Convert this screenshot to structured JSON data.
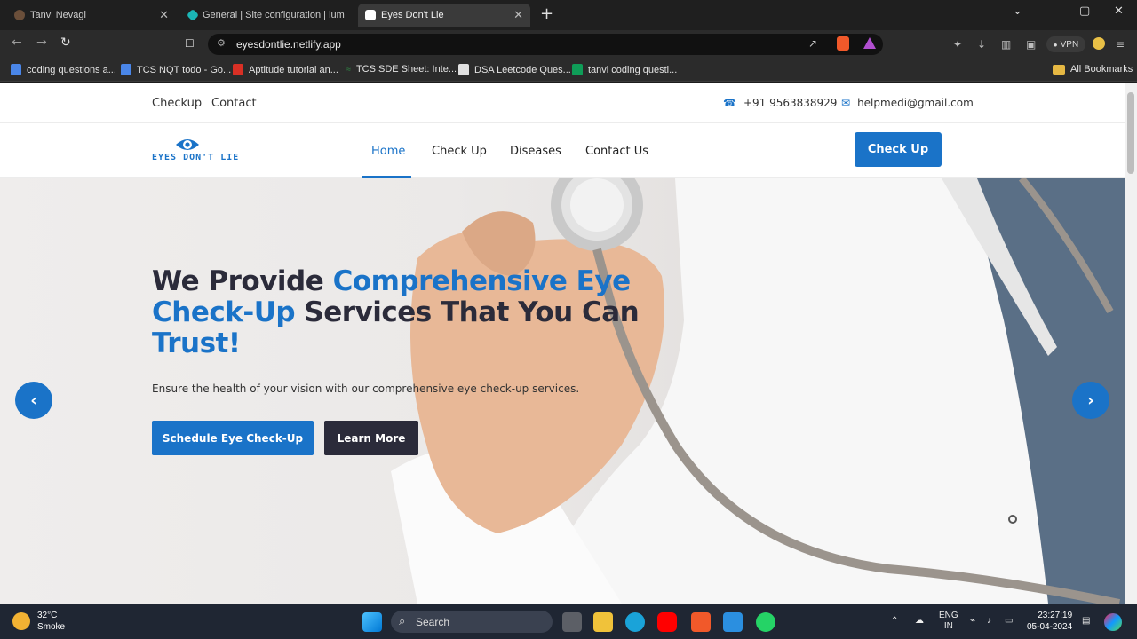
{
  "browser": {
    "tabs": [
      {
        "label": "Tanvi Nevagi",
        "active": false
      },
      {
        "label": "General | Site configuration | lumino",
        "active": false
      },
      {
        "label": "Eyes Don't Lie",
        "active": true
      }
    ],
    "new_tab": "+",
    "window_controls": {
      "chevron": "⌄",
      "minimize": "—",
      "maximize": "▢",
      "close": "✕"
    },
    "url": "eyesdontlie.netlify.app",
    "vpn_label": "VPN",
    "bookmarks": [
      {
        "label": "coding questions a...",
        "color": "#4a86e8"
      },
      {
        "label": "TCS NQT todo - Go...",
        "color": "#4a86e8"
      },
      {
        "label": "Aptitude tutorial an...",
        "color": "#d93025"
      },
      {
        "label": "TCS SDE Sheet: Inte...",
        "color": "#2f8d46"
      },
      {
        "label": "DSA Leetcode Ques...",
        "color": "#e0e0e0"
      },
      {
        "label": "tanvi coding questi...",
        "color": "#0f9d58"
      }
    ],
    "all_bookmarks": "All Bookmarks"
  },
  "site": {
    "top_links": [
      "Checkup",
      "Contact"
    ],
    "phone": "+91 9563838929",
    "email": "helpmedi@gmail.com",
    "logo_text": "EYES DON'T LIE",
    "nav": [
      {
        "label": "Home",
        "active": true
      },
      {
        "label": "Check Up",
        "active": false
      },
      {
        "label": "Diseases",
        "active": false
      },
      {
        "label": "Contact Us",
        "active": false
      }
    ],
    "cta": "Check Up",
    "hero": {
      "title_1": "We Provide ",
      "title_2": "Comprehensive Eye Check-Up",
      "title_3": " Services That You Can ",
      "title_4": "Trust!",
      "subtitle": "Ensure the health of your vision with our comprehensive eye check-up services.",
      "primary_button": "Schedule Eye Check-Up",
      "secondary_button": "Learn More",
      "prev": "‹",
      "next": "›"
    },
    "accent": "#1a73c8",
    "dark": "#2b2b3a"
  },
  "taskbar": {
    "temperature": "32°C",
    "weather": "Smoke",
    "search_placeholder": "Search",
    "lang_1": "ENG",
    "lang_2": "IN",
    "time": "23:27:19",
    "date": "05-04-2024"
  }
}
